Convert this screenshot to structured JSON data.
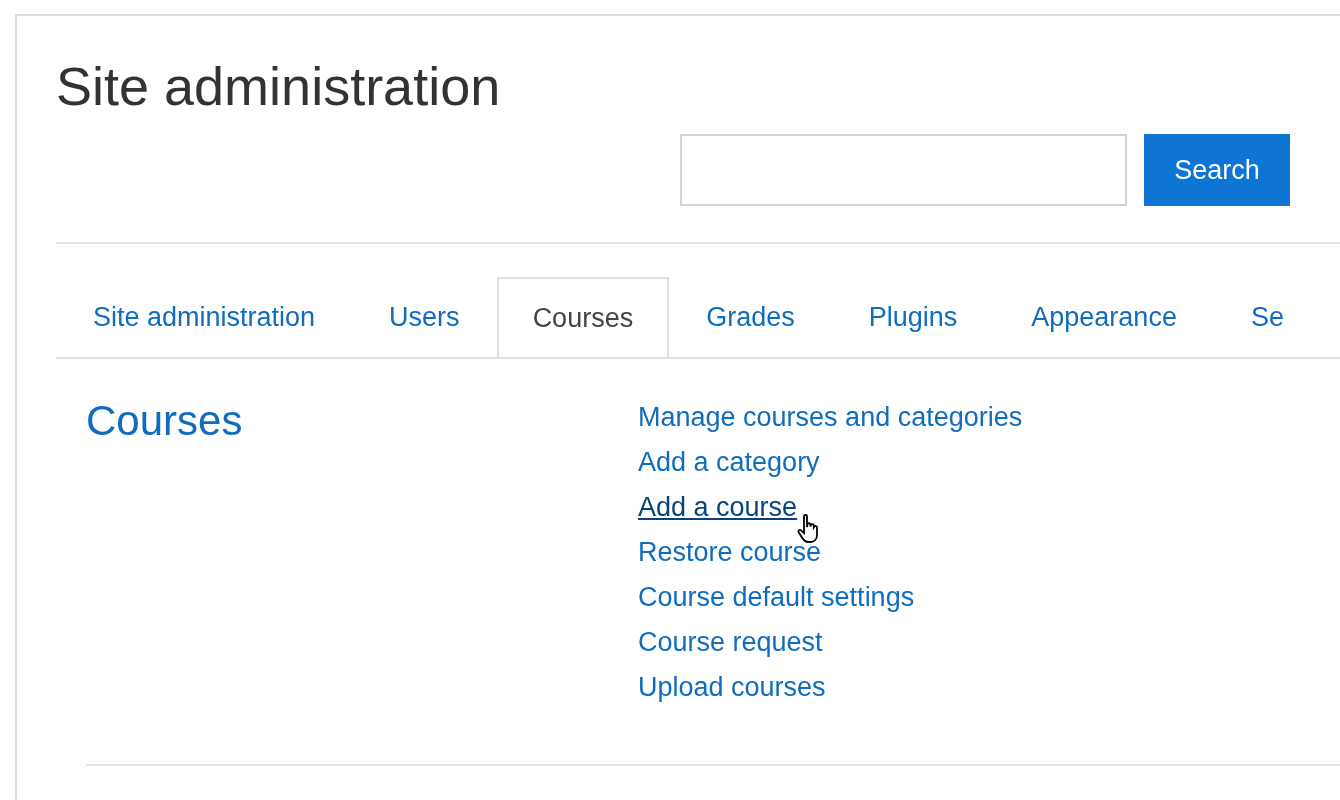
{
  "page": {
    "title": "Site administration"
  },
  "search": {
    "button": "Search"
  },
  "tabs": [
    {
      "label": "Site administration",
      "selected": false
    },
    {
      "label": "Users",
      "selected": false
    },
    {
      "label": "Courses",
      "selected": true
    },
    {
      "label": "Grades",
      "selected": false
    },
    {
      "label": "Plugins",
      "selected": false
    },
    {
      "label": "Appearance",
      "selected": false
    },
    {
      "label": "Se",
      "selected": false
    }
  ],
  "section": {
    "heading": "Courses",
    "links": [
      {
        "label": "Manage courses and categories",
        "hovered": false
      },
      {
        "label": "Add a category",
        "hovered": false
      },
      {
        "label": "Add a course",
        "hovered": true
      },
      {
        "label": "Restore course",
        "hovered": false
      },
      {
        "label": "Course default settings",
        "hovered": false
      },
      {
        "label": "Course request",
        "hovered": false
      },
      {
        "label": "Upload courses",
        "hovered": false
      }
    ]
  }
}
